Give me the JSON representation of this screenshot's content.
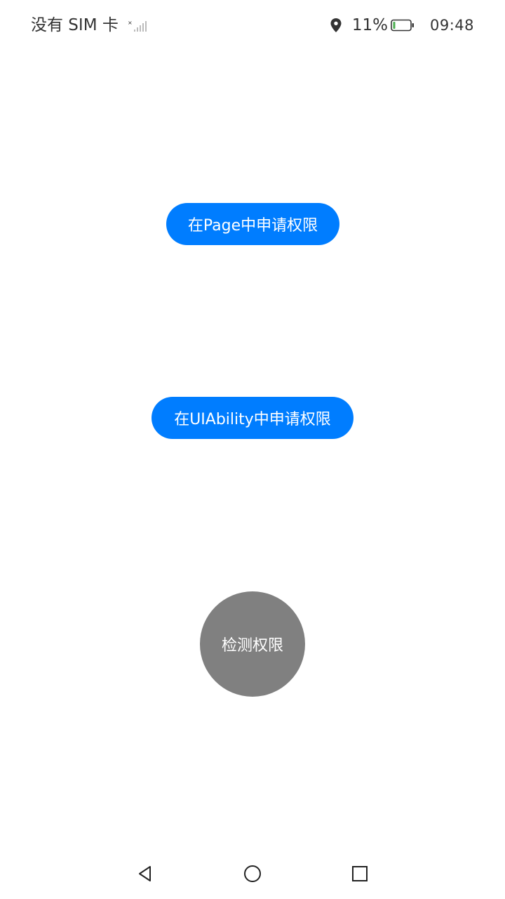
{
  "status_bar": {
    "sim_status": "没有 SIM 卡",
    "battery_percent": "11%",
    "time": "09:48",
    "icons": [
      "signal-icon",
      "location-icon",
      "battery-icon"
    ]
  },
  "main": {
    "request_in_page_label": "在Page中申请权限",
    "request_in_uiability_label": "在UIAbility中申请权限",
    "check_permission_label": "检测权限"
  },
  "nav_bar": {
    "icons": [
      "back-icon",
      "home-icon",
      "recent-apps-icon"
    ]
  },
  "colors": {
    "primary_button": "#007dff",
    "secondary_button": "#808080",
    "background": "#ffffff",
    "text_dark": "#333333",
    "battery_low": "#4caf50"
  }
}
